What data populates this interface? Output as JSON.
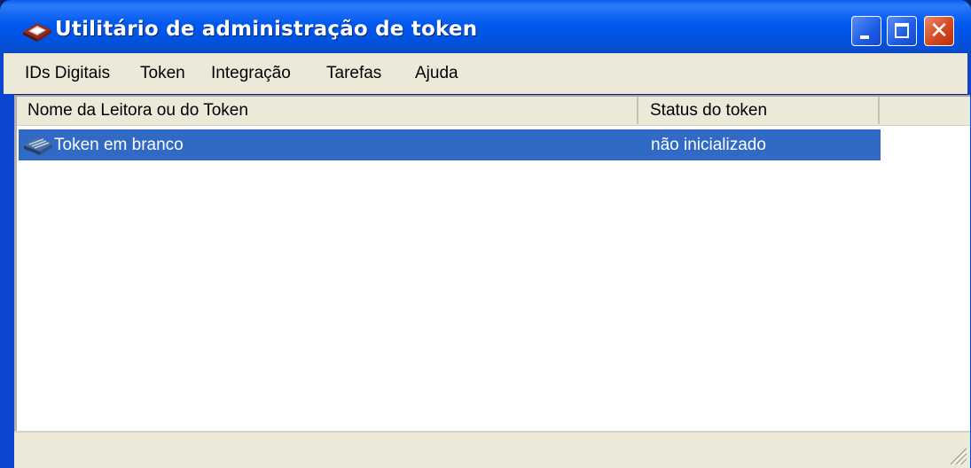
{
  "window": {
    "title": "Utilitário de administração de token",
    "app_icon": "token-drive-icon",
    "controls": {
      "minimize": "minimize-icon",
      "maximize": "maximize-icon",
      "close": "close-icon",
      "close_glyph": "✕"
    }
  },
  "menubar": {
    "items": [
      {
        "label": "IDs Digitais"
      },
      {
        "label": "Token"
      },
      {
        "label": "Integração"
      },
      {
        "label": "Tarefas"
      },
      {
        "label": "Ajuda"
      }
    ]
  },
  "list": {
    "columns": [
      "Nome da Leitora ou do Token",
      "Status do token"
    ],
    "rows": [
      {
        "name": "Token em branco",
        "status": "não inicializado",
        "icon": "token-icon",
        "selected": true
      }
    ]
  },
  "colors": {
    "titlebar": "#0054e3",
    "selection": "#316ac5",
    "chrome": "#ece9d8"
  }
}
